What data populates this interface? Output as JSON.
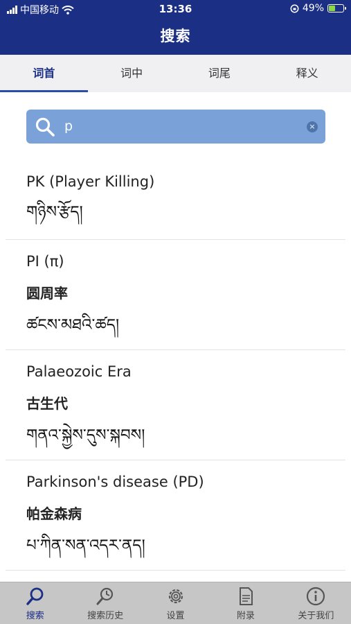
{
  "status_bar": {
    "carrier": "中国移动",
    "time": "13:36",
    "battery_percent": "49%",
    "battery_level": 0.49,
    "icons": [
      "signal-icon",
      "wifi-icon",
      "orientation-lock-icon",
      "battery-icon"
    ]
  },
  "header": {
    "title": "搜索"
  },
  "tabs": [
    {
      "label": "词首",
      "active": true
    },
    {
      "label": "词中",
      "active": false
    },
    {
      "label": "词尾",
      "active": false
    },
    {
      "label": "释义",
      "active": false
    }
  ],
  "search": {
    "value": "p",
    "icon": "search-icon",
    "clear_icon": "clear-icon",
    "clear_glyph": "×"
  },
  "results": [
    {
      "english": "PK (Player Killing)",
      "chinese": "",
      "tibetan": "གཉིས་རྩོད།"
    },
    {
      "english": "PI (π)",
      "chinese": "圆周率",
      "tibetan": "ཚངས་མཐའི་ཚད།"
    },
    {
      "english": "Palaeozoic Era",
      "chinese": "古生代",
      "tibetan": "གནའ་སྐྱེས་དུས་སྐབས།"
    },
    {
      "english": "Parkinson's disease (PD)",
      "chinese": "帕金森病",
      "tibetan": "པ་ཀིན་སན་འདར་ནད།"
    }
  ],
  "tab_bar": [
    {
      "label": "搜索",
      "icon": "search-icon",
      "active": true
    },
    {
      "label": "搜索历史",
      "icon": "history-icon",
      "active": false
    },
    {
      "label": "设置",
      "icon": "gear-icon",
      "active": false
    },
    {
      "label": "附录",
      "icon": "document-icon",
      "active": false
    },
    {
      "label": "关于我们",
      "icon": "info-icon",
      "active": false
    }
  ],
  "colors": {
    "header_bg": "#1b2f85",
    "search_bg": "#7aa2d9",
    "active_tab": "#1b2f85",
    "tab_bar_bg": "#c6c6c6"
  }
}
